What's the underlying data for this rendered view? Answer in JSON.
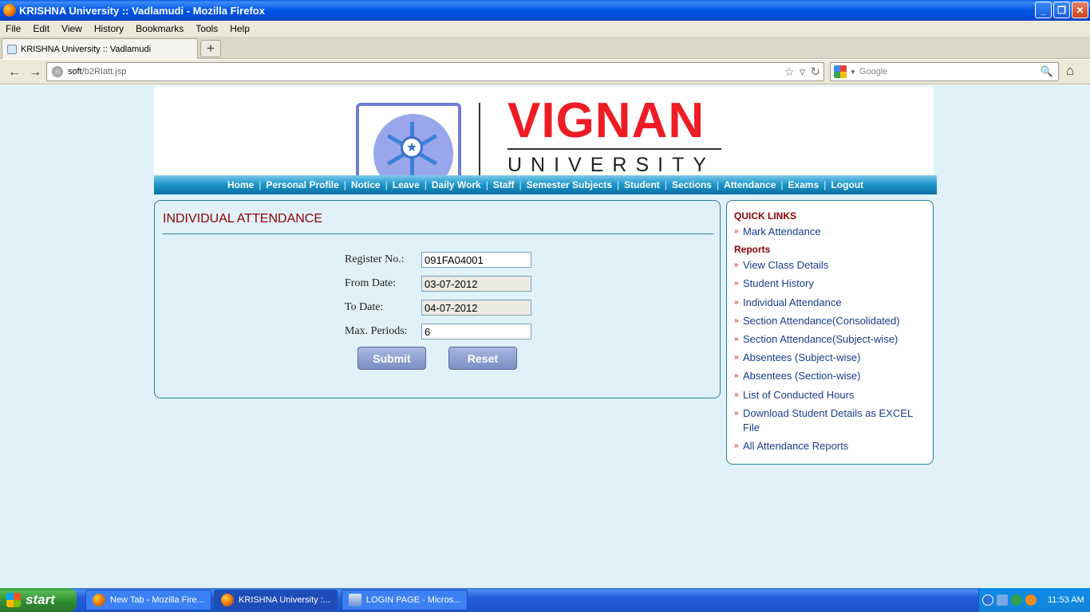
{
  "window": {
    "title": "KRISHNA University :: Vadlamudi - Mozilla Firefox",
    "controls": {
      "minimize": "_",
      "maximize": "❐",
      "close": "✕"
    }
  },
  "menubar": [
    "File",
    "Edit",
    "View",
    "History",
    "Bookmarks",
    "Tools",
    "Help"
  ],
  "tab": {
    "title": "KRISHNA University :: Vadlamudi",
    "new_tab": "+"
  },
  "navbar": {
    "url_host": "soft",
    "url_path": "/b2RIatt.jsp",
    "search_placeholder": "Google"
  },
  "header": {
    "brand": "VIGNAN",
    "brand_sub": "UNIVERSITY"
  },
  "sitenav": [
    "Home",
    "Personal Profile",
    "Notice",
    "Leave",
    "Daily Work",
    "Staff",
    "Semester Subjects",
    "Student",
    "Sections",
    "Attendance",
    "Exams",
    "Logout"
  ],
  "form": {
    "title": "INDIVIDUAL ATTENDANCE",
    "register_label": "Register No.:",
    "register_value": "091FA04001",
    "from_label": "From Date:",
    "from_value": "03-07-2012",
    "to_label": "To Date:",
    "to_value": "04-07-2012",
    "periods_label": "Max. Periods:",
    "periods_value": "6",
    "submit": "Submit",
    "reset": "Reset"
  },
  "quicklinks": {
    "heading": "QUICK LINKS",
    "mark": "Mark Attendance",
    "reports_heading": "Reports",
    "items": [
      "View Class Details",
      "Student History",
      "Individual Attendance",
      "Section Attendance(Consolidated)",
      "Section Attendance(Subject-wise)",
      "Absentees (Subject-wise)",
      "Absentees (Section-wise)",
      "List of Conducted Hours",
      "Download Student Details as EXCEL File",
      "All Attendance Reports"
    ]
  },
  "taskbar": {
    "start": "start",
    "tasks": [
      "New Tab - Mozilla Fire...",
      "KRISHNA University :...",
      "LOGIN PAGE - Micros..."
    ],
    "clock": "11:53 AM"
  },
  "colors": {
    "title_bar": "#0055e5",
    "page_bg": "#e1f1f9",
    "nav_bar": "#1e98cc",
    "heading_red": "#8b0000",
    "brand_red": "#ee1c25",
    "link_blue": "#1a3c8c"
  }
}
